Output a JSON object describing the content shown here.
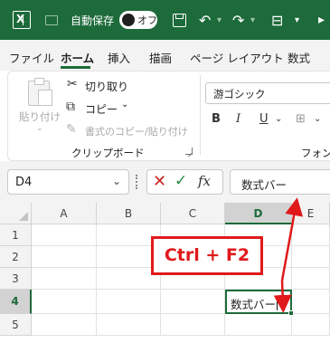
{
  "titlebar": {
    "autosave_label": "自動保存",
    "toggle_label": "オフ"
  },
  "menu": {
    "tabs": [
      "ファイル",
      "ホーム",
      "挿入",
      "描画",
      "ページ レイアウト",
      "数式"
    ],
    "active": "ホーム"
  },
  "ribbon": {
    "paste_label": "貼り付け",
    "cut_label": "切り取り",
    "copy_label": "コピー",
    "format_painter_label": "書式のコピー/貼り付け",
    "clipboard_group_label": "クリップボード",
    "font_name": "游ゴシック",
    "font_group_label": "フォント",
    "bold_label": "B",
    "italic_label": "I",
    "underline_label": "U"
  },
  "formula_row": {
    "namebox_value": "D4",
    "fx_label": "fx",
    "formula_value": "数式バー"
  },
  "grid": {
    "columns": [
      "A",
      "B",
      "C",
      "D",
      "E"
    ],
    "rows": [
      "1",
      "2",
      "3",
      "4",
      "5"
    ],
    "selected_column": "D",
    "selected_row": "4",
    "active_cell_value": "数式バー"
  },
  "annotation": {
    "callout_text": "Ctrl + F2",
    "color": "#e0191b"
  },
  "colors": {
    "accent": "#1d6b3a",
    "titlebar_bg": "#1d6b3a"
  }
}
